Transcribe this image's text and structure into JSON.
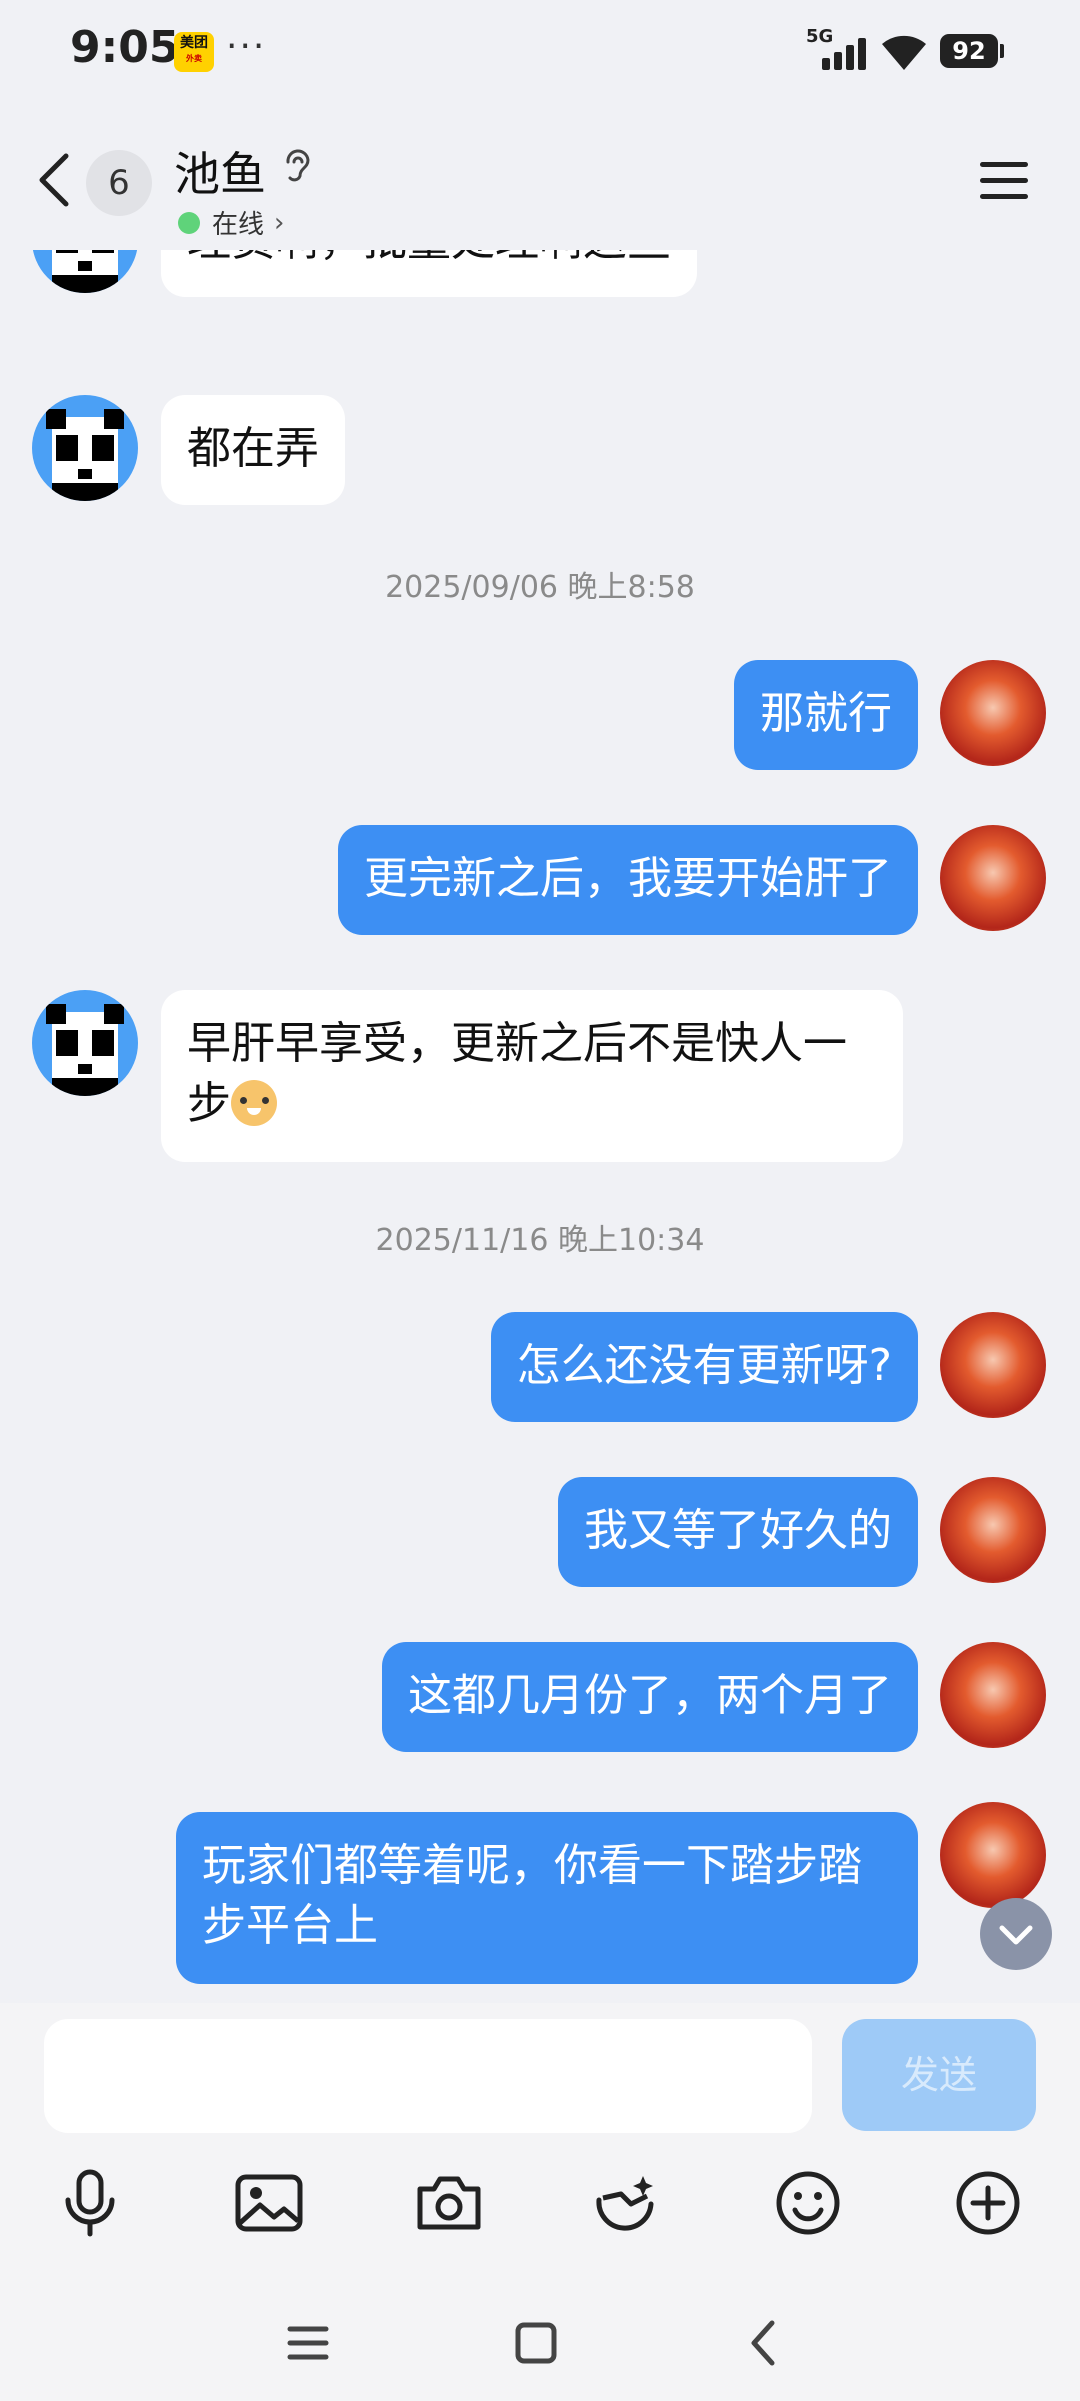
{
  "status_bar": {
    "time": "9:05",
    "app_badge": "美团",
    "app_badge_sub": "外卖",
    "more": "···",
    "network": "5G",
    "battery": "92"
  },
  "header": {
    "unread_count": "6",
    "title": "池鱼",
    "status": "在线"
  },
  "messages": [
    {
      "side": "in",
      "text": "理货啊，批量处理啊这些"
    },
    {
      "side": "in",
      "text": "都在弄"
    },
    {
      "type": "timestamp",
      "text": "2025/09/06 晚上8:58"
    },
    {
      "side": "out",
      "text": "那就行"
    },
    {
      "side": "out",
      "text": "更完新之后，我要开始肝了"
    },
    {
      "side": "in",
      "text_line1": "早肝早享受，更新之后不是快人一",
      "text_line2": "步"
    },
    {
      "type": "timestamp",
      "text": "2025/11/16 晚上10:34"
    },
    {
      "side": "out",
      "text": "怎么还没有更新呀?"
    },
    {
      "side": "out",
      "text": "我又等了好久的"
    },
    {
      "side": "out",
      "text": "这都几月份了，两个月了"
    },
    {
      "side": "out",
      "text_line1": "玩家们都等着呢，你看一下踏步踏",
      "text_line2": "步平台上"
    }
  ],
  "input": {
    "value": "",
    "send_label": "发送"
  },
  "toolbar_icons": [
    "microphone-icon",
    "image-icon",
    "camera-icon",
    "sticker-icon",
    "emoji-icon",
    "plus-icon"
  ],
  "colors": {
    "background": "#f0f1f5",
    "bubble_out": "#3d8ff3",
    "bubble_in": "#ffffff",
    "online": "#5fd37a",
    "send_disabled": "#9ecaf7"
  }
}
